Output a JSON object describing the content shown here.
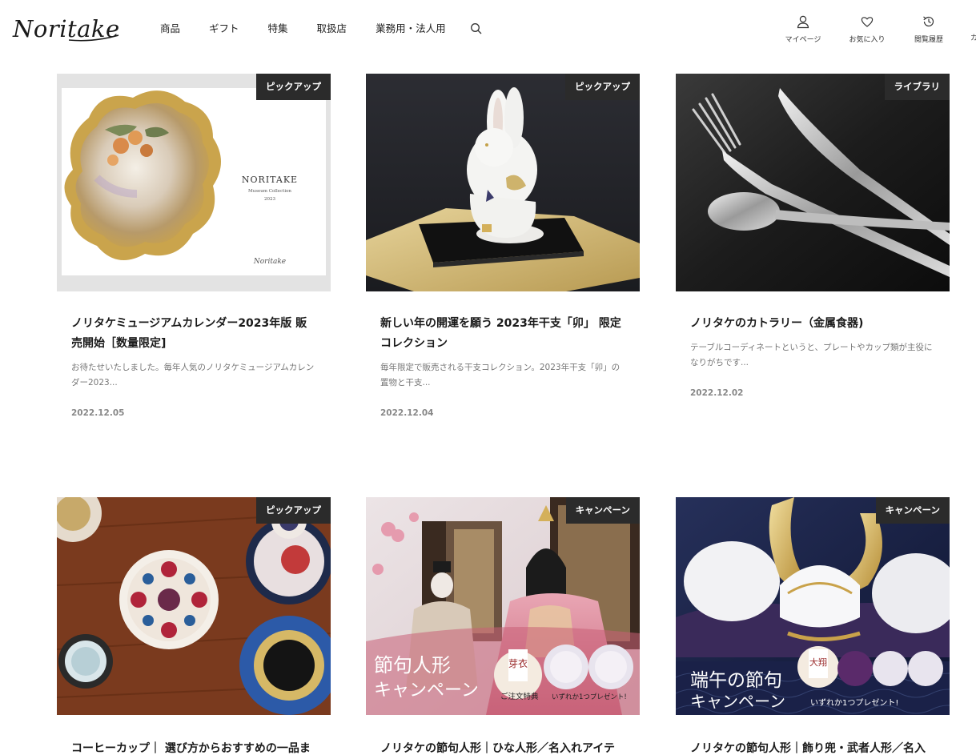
{
  "header": {
    "logo_text": "Noritake",
    "nav": [
      "商品",
      "ギフト",
      "特集",
      "取扱店",
      "業務用・法人用"
    ],
    "utility": [
      {
        "label": "マイページ",
        "icon": "user-icon"
      },
      {
        "label": "お気に入り",
        "icon": "heart-icon"
      },
      {
        "label": "閲覧履歴",
        "icon": "history-icon"
      }
    ],
    "edge_glyph": "カ"
  },
  "cards": [
    {
      "badge": "ピックアップ",
      "title": "ノリタケミュージアムカレンダー2023年版 販売開始［数量限定]",
      "excerpt": "お待たせいたしました。毎年人気のノリタケミュージアムカレンダー2023...",
      "date": "2022.12.05",
      "image_text": {
        "brand": "NORITAKE",
        "line": "Museum Collection",
        "year": "2023",
        "signature": "Noritake"
      }
    },
    {
      "badge": "ピックアップ",
      "title": "新しい年の開運を願う 2023年干支「卯」 限定コレクション",
      "excerpt": "毎年限定で販売される干支コレクション。2023年干支「卯」の置物と干支...",
      "date": "2022.12.04"
    },
    {
      "badge": "ライブラリ",
      "title": "ノリタケのカトラリー（金属食器)",
      "excerpt": "テーブルコーディネートというと、プレートやカップ類が主役になりがちです...",
      "date": "2022.12.02"
    },
    {
      "badge": "ピックアップ",
      "title": "コーヒーカップ｜ 選び方からおすすめの一品ま"
    },
    {
      "badge": "キャンペーン",
      "title": "ノリタケの節句人形｜ひな人形／名入れアイテ",
      "image_text": {
        "headline1": "節句人形",
        "headline2": "キャンペーン",
        "sub1": "ご注文特典",
        "sub2": "いずれか1つプレゼント!",
        "tag": "芽衣"
      }
    },
    {
      "badge": "キャンペーン",
      "title": "ノリタケの節句人形｜飾り兜・武者人形／名入",
      "image_text": {
        "headline1": "端午の節句",
        "headline2": "キャンペーン",
        "sub": "いずれか1つプレゼント!",
        "tag": "大翔"
      }
    }
  ]
}
